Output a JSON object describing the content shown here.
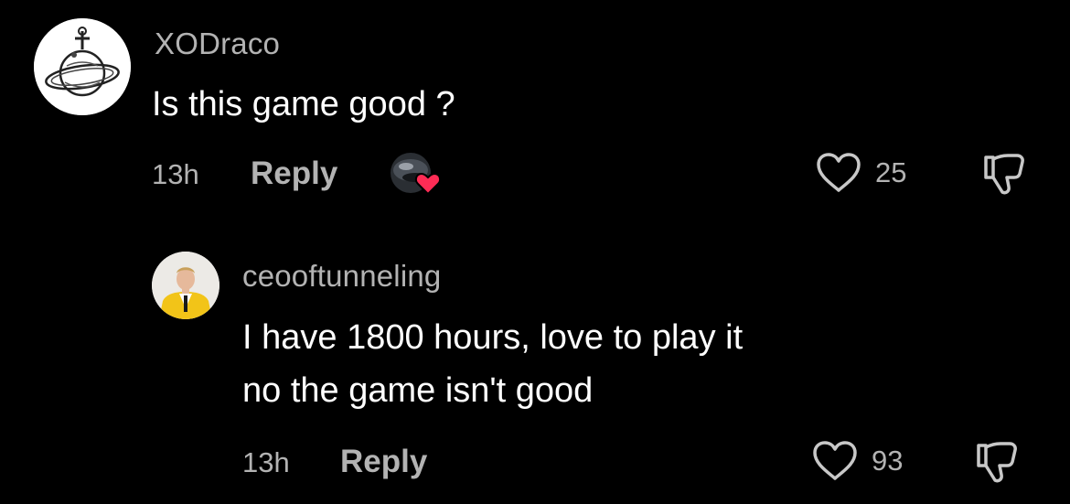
{
  "comments": [
    {
      "username": "XODraco",
      "text": "Is this game good ?",
      "time": "13h",
      "reply_label": "Reply",
      "likes": "25",
      "creator_liked": true
    },
    {
      "username": "ceooftunneling",
      "text_line1": "I have 1800 hours, love to play it",
      "text_line2": "no the game isn't good",
      "time": "13h",
      "reply_label": "Reply",
      "likes": "93"
    }
  ],
  "colors": {
    "background": "#000000",
    "primary_text": "#ffffff",
    "secondary_text": "#b3b3b3",
    "heart_red": "#fe2c55"
  },
  "icons": {
    "like": "heart-outline-icon",
    "dislike": "thumbs-down-icon",
    "creator_like": "creator-avatar-heart-icon"
  }
}
